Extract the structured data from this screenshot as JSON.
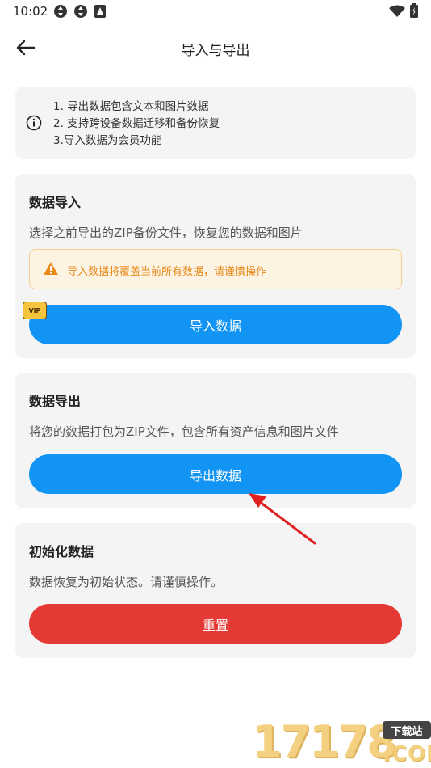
{
  "status_bar": {
    "time": "10:02",
    "icons": [
      "sync-icon",
      "sync-icon",
      "notification-icon",
      "wifi-icon",
      "battery-icon"
    ]
  },
  "header": {
    "title": "导入与导出",
    "back_icon": "back-arrow-icon"
  },
  "info": {
    "icon": "info-icon",
    "lines": [
      "1. 导出数据包含文本和图片数据",
      "2. 支持跨设备数据迁移和备份恢复",
      "3.导入数据为会员功能"
    ]
  },
  "import_section": {
    "title": "数据导入",
    "description": "选择之前导出的ZIP备份文件，恢复您的数据和图片",
    "warning_icon": "warning-icon",
    "warning": "导入数据将覆盖当前所有数据，请谨慎操作",
    "vip_badge": "VIP",
    "button_label": "导入数据"
  },
  "export_section": {
    "title": "数据导出",
    "description": "将您的数据打包为ZIP文件，包含所有资产信息和图片文件",
    "button_label": "导出数据"
  },
  "reset_section": {
    "title": "初始化数据",
    "description": "数据恢复为初始状态。请谨慎操作。",
    "button_label": "重置"
  },
  "watermark": {
    "digits": "17178",
    "badge": "下载站",
    "domain": ".COM"
  },
  "colors": {
    "primary_button": "#1294f5",
    "danger_button": "#e53935",
    "warning_text": "#e8891a",
    "warning_bg": "#fdf3e3",
    "card_bg": "#f4f4f4",
    "annotation_arrow": "#e02020"
  }
}
